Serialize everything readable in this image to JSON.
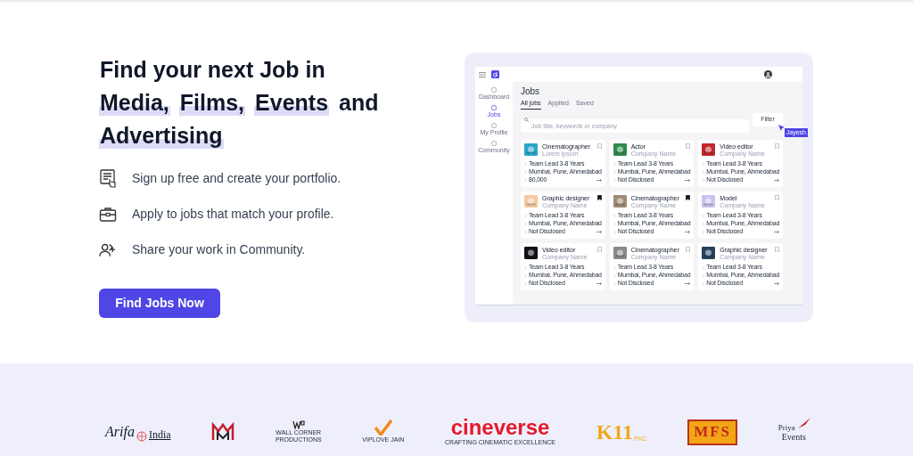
{
  "hero": {
    "headline": [
      [
        {
          "text": "Find your next Job in",
          "highlighted": false
        }
      ],
      [
        {
          "text": "Media,",
          "highlighted": true
        },
        {
          "text": "Films,",
          "highlighted": true
        },
        {
          "text": "Events",
          "highlighted": true
        },
        {
          "text": "and",
          "highlighted": false
        }
      ],
      [
        {
          "text": "Advertising",
          "highlighted": true
        }
      ]
    ],
    "features": [
      {
        "kind": "portfolio",
        "text": "Sign up free and create your portfolio."
      },
      {
        "kind": "briefcase",
        "text": "Apply to jobs that match your profile."
      },
      {
        "kind": "people",
        "text": "Share your work in Community."
      }
    ],
    "cta": "Find Jobs Now"
  },
  "preview": {
    "sidebar": [
      {
        "label": "Dashboard",
        "selected": false
      },
      {
        "label": "Jobs",
        "selected": true
      },
      {
        "label": "My Profile",
        "selected": false
      },
      {
        "label": "Community",
        "selected": false
      }
    ],
    "title": "Jobs",
    "tabs": [
      {
        "label": "All jobs",
        "selected": true
      },
      {
        "label": "Applied",
        "selected": false
      },
      {
        "label": "Saved",
        "selected": false
      }
    ],
    "search": {
      "placeholder": "Job title, keywords or company"
    },
    "filter": "Filter",
    "cursor_label": "Jayesh",
    "cards": [
      {
        "title": "Cinematographer",
        "company": "Lorem ipsum",
        "experience": "Team Lead 3-8 Years",
        "location": "Mumbai, Pune, Ahmedabad",
        "salary": "80,000",
        "saved": false,
        "color": "#2aa6c9"
      },
      {
        "title": "Actor",
        "company": "Company Name",
        "experience": "Team Lead 3-8 Years",
        "location": "Mumbai, Pune, Ahmedabad",
        "salary": "Not Disclosed",
        "saved": false,
        "color": "#2f8a4e"
      },
      {
        "title": "Video editor",
        "company": "Company Name",
        "experience": "Team Lead 3-8 Years",
        "location": "Mumbai, Pune, Ahmedabad",
        "salary": "Not Disclosed",
        "saved": false,
        "color": "#c0282d"
      },
      {
        "title": "Graphic designer",
        "company": "Company Name",
        "experience": "Team Lead 3-8 Years",
        "location": "Mumbai, Pune, Ahmedabad",
        "salary": "Not Disclosed",
        "saved": true,
        "color": "#f6c9a0"
      },
      {
        "title": "Cinematographer",
        "company": "Company Name",
        "experience": "Team Lead 3-8 Years",
        "location": "Mumbai, Pune, Ahmedabad",
        "salary": "Not Disclosed",
        "saved": true,
        "color": "#a08b74"
      },
      {
        "title": "Model",
        "company": "Company Name",
        "experience": "Team Lead 3-8 Years",
        "location": "Mumbai, Pune, Ahmedabad",
        "salary": "Not Disclosed",
        "saved": false,
        "color": "#c9c2ee"
      },
      {
        "title": "Video editor",
        "company": "Company Name",
        "experience": "Team Lead 3-8 Years",
        "location": "Mumbai, Pune, Ahmedabad",
        "salary": "Not Disclosed",
        "saved": false,
        "color": "#101018"
      },
      {
        "title": "Cinematographer",
        "company": "Company Name",
        "experience": "Team Lead 3-8 Years",
        "location": "Mumbai, Pune, Ahmedabad",
        "salary": "Not Disclosed",
        "saved": false,
        "color": "#8a8a8a"
      },
      {
        "title": "Graphic designer",
        "company": "Company Name",
        "experience": "Team Lead 3-8 Years",
        "location": "Mumbai, Pune, Ahmedabad",
        "salary": "Not Disclosed",
        "saved": false,
        "color": "#24415e"
      }
    ]
  },
  "partners": [
    {
      "kind": "arifa",
      "texts": [
        "Arifa",
        "India"
      ]
    },
    {
      "kind": "matrix"
    },
    {
      "kind": "wallcorner",
      "texts": [
        "WALL CORNER",
        "PRODUCTIONS"
      ]
    },
    {
      "kind": "viplove",
      "texts": [
        "VIPLOVE JAIN"
      ]
    },
    {
      "kind": "cineverse",
      "texts": [
        "cineverse",
        "CRAFTING CINEMATIC EXCELLENCE"
      ]
    },
    {
      "kind": "k11",
      "texts": [
        "K11",
        "PKC"
      ]
    },
    {
      "kind": "mfs",
      "texts": [
        "MFS"
      ]
    },
    {
      "kind": "priya",
      "texts": [
        "Priya",
        "Events"
      ]
    }
  ]
}
